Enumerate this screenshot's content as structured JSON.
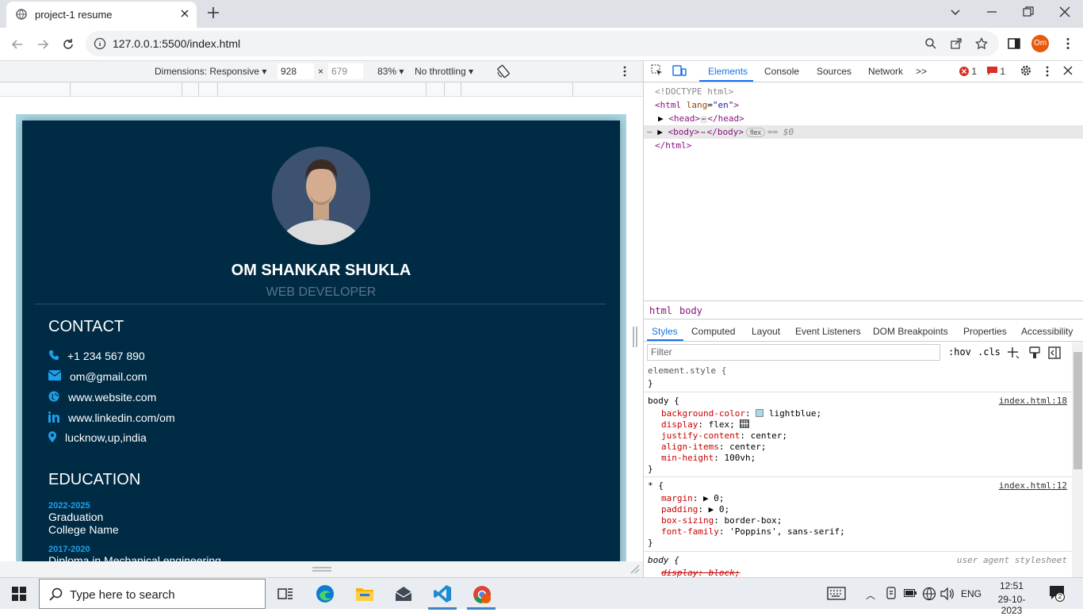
{
  "browser": {
    "tab_title": "project-1 resume",
    "url": "127.0.0.1:5500/index.html",
    "profile_initials": "Om"
  },
  "device_toolbar": {
    "dimensions_label": "Dimensions: Responsive",
    "width": "928",
    "height": "679",
    "zoom": "83%",
    "throttling": "No throttling"
  },
  "resume": {
    "name": "OM SHANKAR SHUKLA",
    "role": "WEB DEVELOPER",
    "contact_title": "CONTACT",
    "contacts": [
      {
        "icon": "phone-icon",
        "text": "+1 234 567 890"
      },
      {
        "icon": "email-icon",
        "text": "om@gmail.com"
      },
      {
        "icon": "globe-icon",
        "text": "www.website.com"
      },
      {
        "icon": "linkedin-icon",
        "text": "www.linkedin.com/om"
      },
      {
        "icon": "location-icon",
        "text": "lucknow,up,india"
      }
    ],
    "education_title": "EDUCATION",
    "education": [
      {
        "years": "2022-2025",
        "degree": "Graduation",
        "school": "College Name"
      },
      {
        "years": "2017-2020",
        "degree": "Diploma in Mechanical engineering",
        "school": ""
      }
    ],
    "colors": {
      "card": "#002b45",
      "page_bg": "lightblue",
      "accent": "#1ea0e8"
    }
  },
  "devtools": {
    "tabs": [
      "Elements",
      "Console",
      "Sources",
      "Network"
    ],
    "more_tabs": ">>",
    "error_count": "1",
    "issue_count": "1",
    "dom": {
      "doctype": "<!DOCTYPE html>",
      "html_open": "<html",
      "lang_attr": "lang",
      "lang_val": "\"en\"",
      "head": "<head>",
      "head_close": "</head>",
      "body": "<body>",
      "body_close": "</body>",
      "flex_badge": "flex",
      "selected_marker": "== $0",
      "html_close": "</html>"
    },
    "breadcrumbs": [
      "html",
      "body"
    ],
    "subtabs": [
      "Styles",
      "Computed",
      "Layout",
      "Event Listeners",
      "DOM Breakpoints",
      "Properties",
      "Accessibility"
    ],
    "filter_placeholder": "Filter",
    "hov": ":hov",
    "cls": ".cls",
    "rules": {
      "element_style": "element.style {",
      "close": "}",
      "body_selector": "body {",
      "body_source": "index.html:18",
      "body_props": [
        {
          "name": "background-color",
          "value": "lightblue;"
        },
        {
          "name": "display",
          "value": "flex;"
        },
        {
          "name": "justify-content",
          "value": "center;"
        },
        {
          "name": "align-items",
          "value": "center;"
        },
        {
          "name": "min-height",
          "value": "100vh;"
        }
      ],
      "star_selector": "* {",
      "star_source": "index.html:12",
      "star_props": [
        {
          "name": "margin",
          "value": "0;"
        },
        {
          "name": "padding",
          "value": "0;"
        },
        {
          "name": "box-sizing",
          "value": "border-box;"
        },
        {
          "name": "font-family",
          "value": "'Poppins', sans-serif;"
        }
      ],
      "ua_selector": "body {",
      "ua_source": "user agent stylesheet",
      "ua_prop": "display: block;"
    }
  },
  "taskbar": {
    "search_placeholder": "Type here to search",
    "language": "ENG",
    "time": "12:51",
    "date": "29-10-2023",
    "notification_count": "2"
  }
}
